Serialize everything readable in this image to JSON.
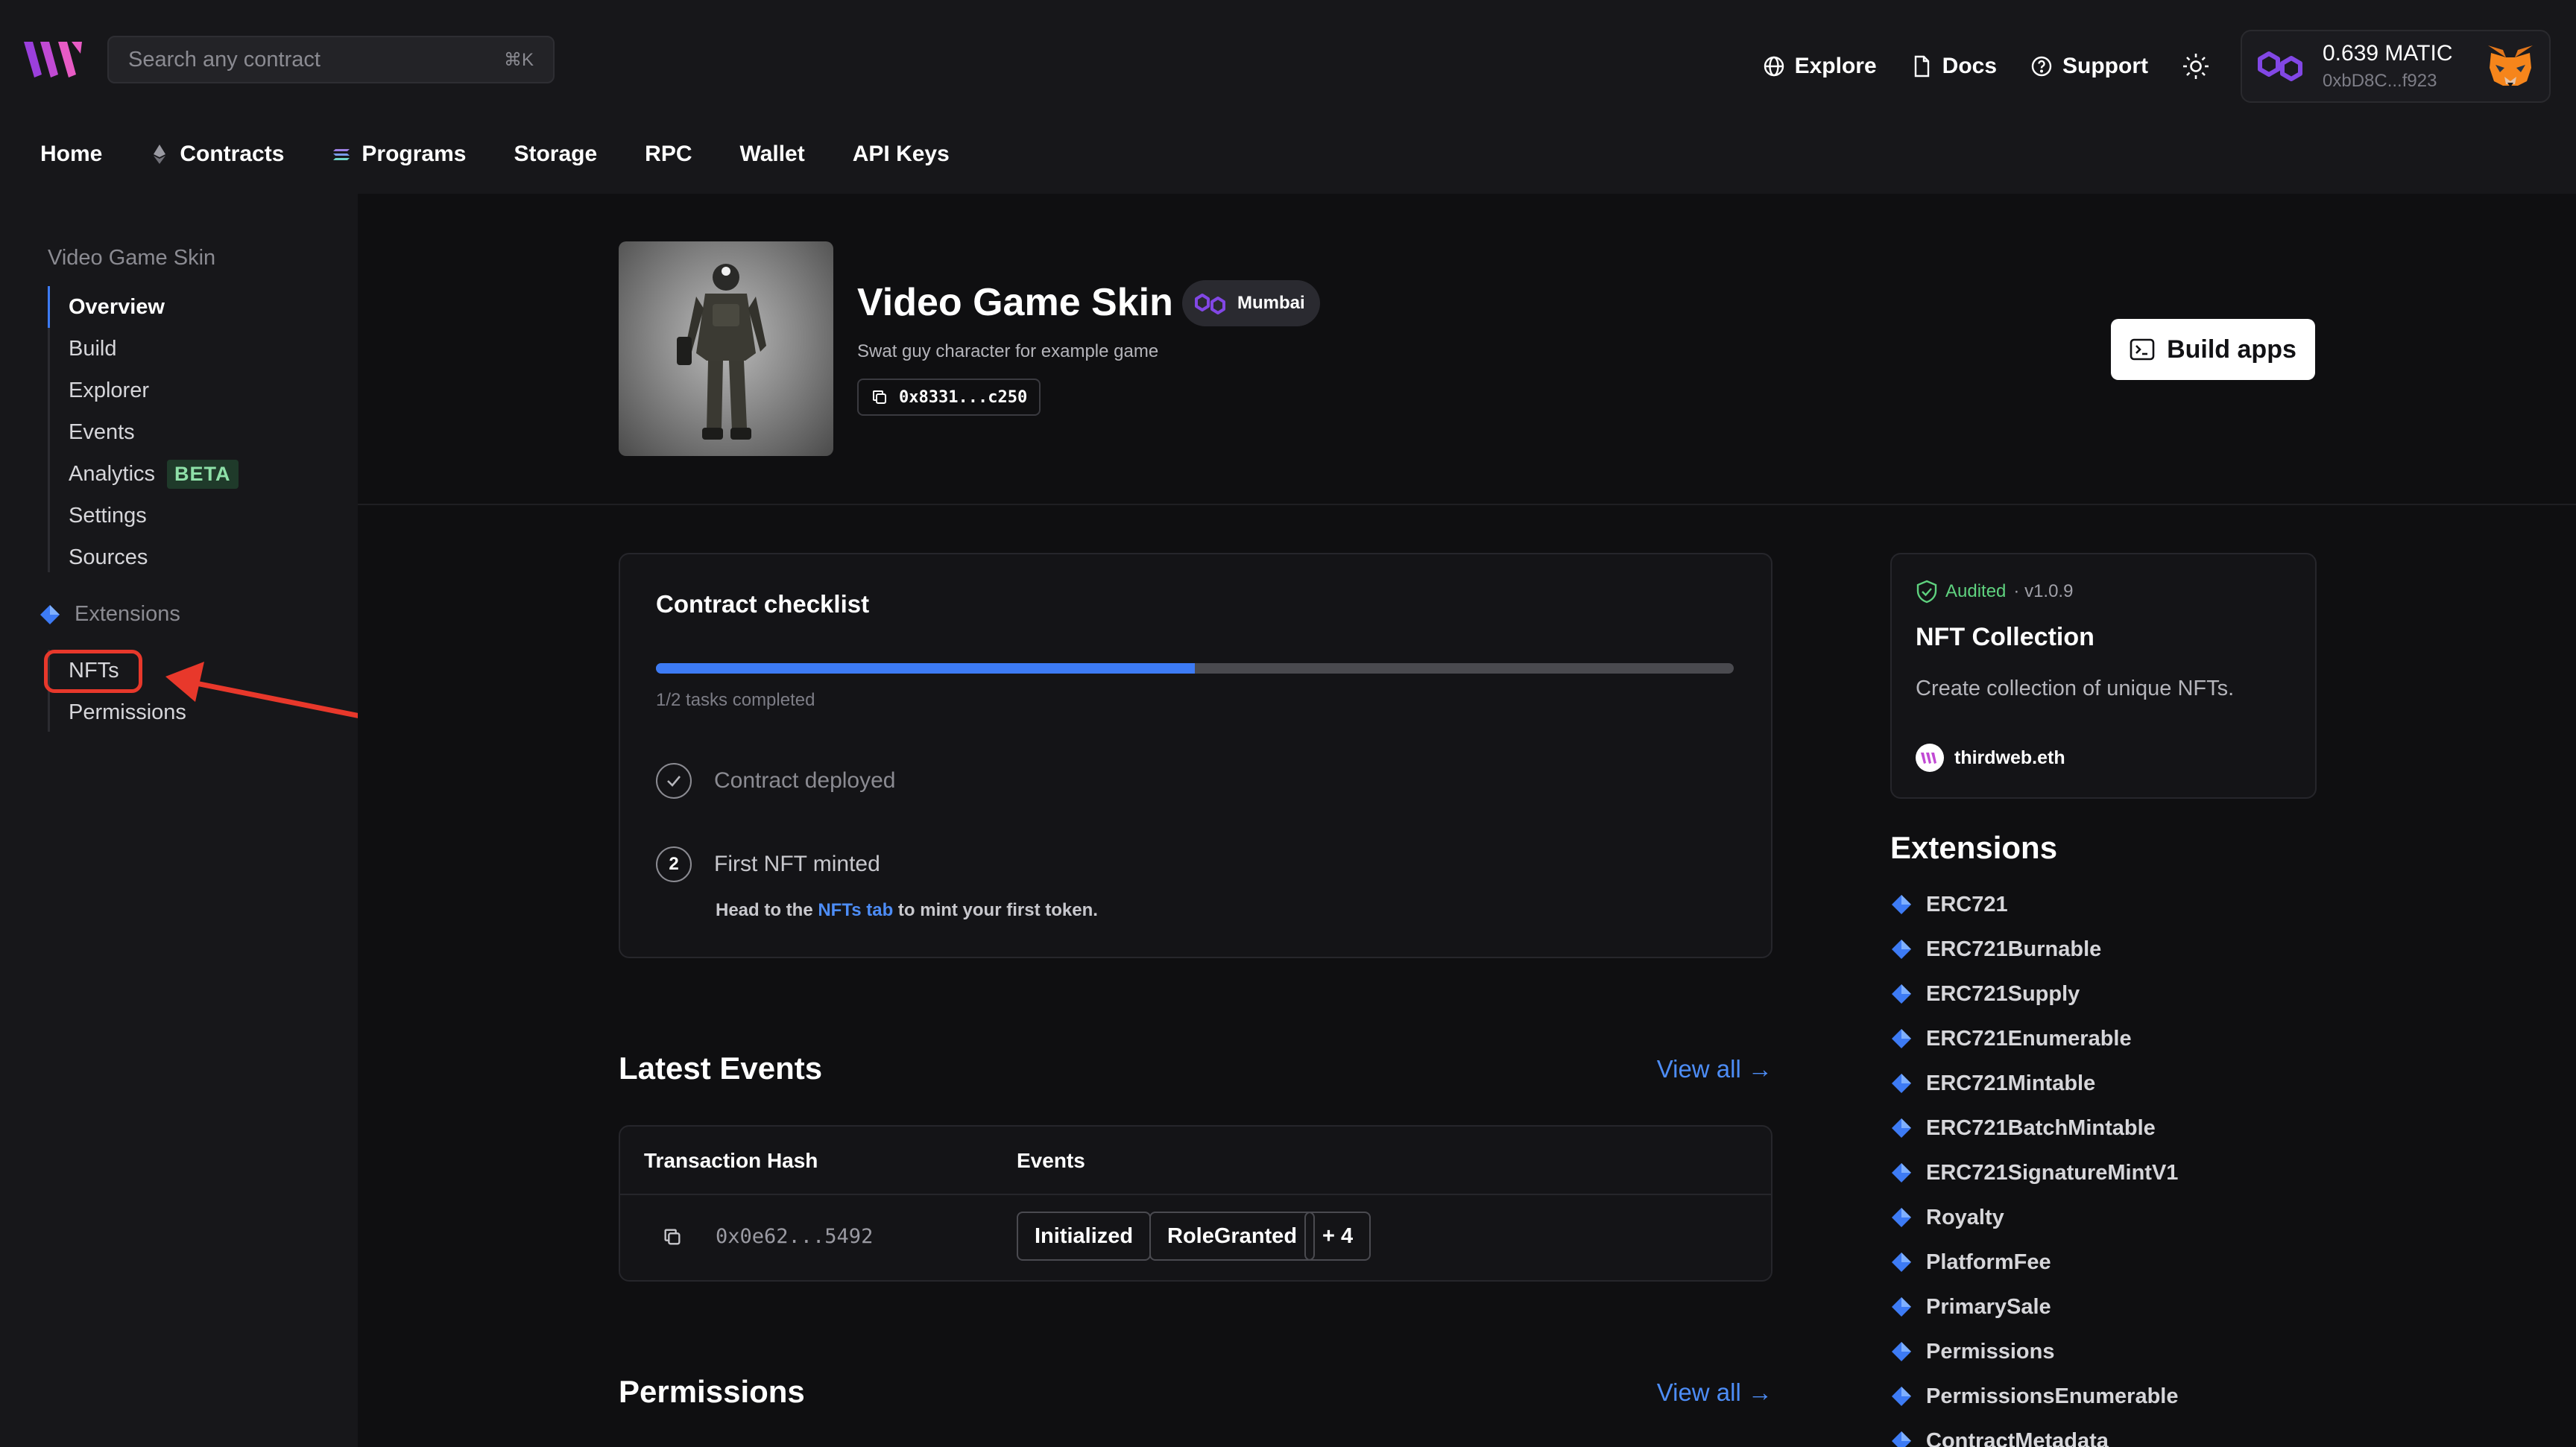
{
  "header": {
    "search_placeholder": "Search any contract",
    "search_shortcut": "⌘K",
    "links": [
      "Explore",
      "Docs",
      "Support"
    ],
    "wallet_balance": "0.639 MATIC",
    "wallet_address": "0xbD8C...f923"
  },
  "nav": [
    "Home",
    "Contracts",
    "Programs",
    "Storage",
    "RPC",
    "Wallet",
    "API Keys"
  ],
  "sidebar": {
    "title": "Video Game Skin",
    "items": [
      "Overview",
      "Build",
      "Explorer",
      "Events",
      "Analytics",
      "Settings",
      "Sources"
    ],
    "beta_label": "BETA",
    "extensions_label": "Extensions",
    "extension_items": [
      "NFTs",
      "Permissions"
    ]
  },
  "contract": {
    "name": "Video Game Skin",
    "chain": "Mumbai",
    "description": "Swat guy character for example game",
    "address": "0x8331...c250",
    "build_button": "Build apps"
  },
  "checklist": {
    "title": "Contract checklist",
    "progress_fraction": 0.5,
    "progress_text": "1/2 tasks completed",
    "step1": "Contract deployed",
    "step2_num": "2",
    "step2": "First NFT minted",
    "hint_pre": "Head to the ",
    "hint_link": "NFTs tab",
    "hint_post": " to mint your first token."
  },
  "latest_events": {
    "title": "Latest Events",
    "view_all": "View all →",
    "col_hash": "Transaction Hash",
    "col_events": "Events",
    "row_hash": "0x0e62...5492",
    "tags": [
      "Initialized",
      "RoleGranted",
      "+ 4"
    ]
  },
  "permissions": {
    "title": "Permissions",
    "view_all": "View all →"
  },
  "audit": {
    "audited": "Audited",
    "version": " · v1.0.9",
    "name": "NFT Collection",
    "description": "Create collection of unique NFTs.",
    "publisher": "thirdweb.eth"
  },
  "extensions": {
    "title": "Extensions",
    "items": [
      "ERC721",
      "ERC721Burnable",
      "ERC721Supply",
      "ERC721Enumerable",
      "ERC721Mintable",
      "ERC721BatchMintable",
      "ERC721SignatureMintV1",
      "Royalty",
      "PlatformFee",
      "PrimarySale",
      "Permissions",
      "PermissionsEnumerable",
      "ContractMetadata"
    ]
  },
  "colors": {
    "accent": "#3d7bf5",
    "annotation_red": "#e8382b",
    "audited_green": "#5fd27f",
    "polygon_purple": "#8247e5"
  },
  "icons": {
    "logo": "thirdweb-logo",
    "explore": "globe-icon",
    "docs": "document-icon",
    "support": "help-circle-icon",
    "theme": "sun-icon",
    "chain": "polygon-icon",
    "copy": "copy-icon",
    "build": "terminal-icon",
    "check": "check-icon",
    "audit": "shield-check-icon",
    "extension": "diamond-icon"
  }
}
